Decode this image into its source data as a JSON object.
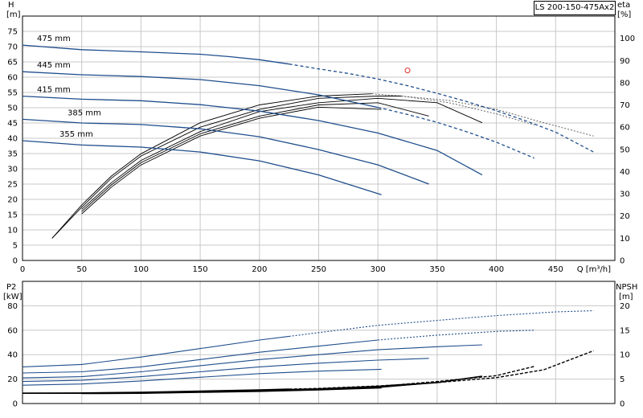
{
  "title": "LS 200-150-475Ax2",
  "chart_data": [
    {
      "type": "line",
      "name": "head-efficiency",
      "xlabel": "Q [m³/h]",
      "xlim": [
        0,
        500
      ],
      "xticks": [
        0,
        50,
        100,
        150,
        200,
        250,
        300,
        350,
        400,
        450
      ],
      "ylabel_left": [
        "H",
        "[m]"
      ],
      "ylim_left": [
        0,
        80
      ],
      "yticks_left": [
        0,
        5,
        10,
        15,
        20,
        25,
        30,
        35,
        40,
        45,
        50,
        55,
        60,
        65,
        70,
        75
      ],
      "ylabel_right": [
        "eta",
        "[%]"
      ],
      "ylim_right": [
        0,
        110
      ],
      "yticks_right": [
        0,
        10,
        20,
        30,
        40,
        50,
        60,
        70,
        80,
        90,
        100
      ],
      "grid": true,
      "colors": {
        "curve": "#1f4e8c",
        "eff": "#000000",
        "eff_dashed": "#555555",
        "marker": "#e03030"
      },
      "operating_point": {
        "x": 325,
        "y": 62.2
      },
      "head_curves": [
        {
          "label": "475 mm",
          "solid_end": 225,
          "points": [
            [
              0,
              70.5
            ],
            [
              50,
              69
            ],
            [
              100,
              68.3
            ],
            [
              150,
              67.5
            ],
            [
              175,
              66.7
            ],
            [
              200,
              65.7
            ],
            [
              225,
              64.3
            ],
            [
              250,
              62.7
            ],
            [
              275,
              61.2
            ],
            [
              300,
              59.4
            ],
            [
              325,
              57.2
            ],
            [
              350,
              54.7
            ],
            [
              375,
              52
            ],
            [
              400,
              49
            ],
            [
              425,
              45.7
            ],
            [
              450,
              42
            ],
            [
              482,
              35.5
            ]
          ]
        },
        {
          "label": "445 mm",
          "solid_end": 300,
          "points": [
            [
              0,
              61.8
            ],
            [
              50,
              60.8
            ],
            [
              100,
              60.2
            ],
            [
              150,
              59.2
            ],
            [
              200,
              57.2
            ],
            [
              250,
              54.2
            ],
            [
              300,
              50.1
            ],
            [
              325,
              47.8
            ],
            [
              350,
              45.2
            ],
            [
              375,
              42.1
            ],
            [
              400,
              38.7
            ],
            [
              432,
              33.5
            ]
          ]
        },
        {
          "label": "415 mm",
          "solid_end": 388,
          "points": [
            [
              0,
              53.8
            ],
            [
              50,
              52.8
            ],
            [
              100,
              52.3
            ],
            [
              150,
              51
            ],
            [
              200,
              48.9
            ],
            [
              250,
              45.8
            ],
            [
              300,
              41.7
            ],
            [
              350,
              36
            ],
            [
              388,
              28
            ]
          ]
        },
        {
          "label": "385 mm",
          "solid_end": 343,
          "points": [
            [
              0,
              46.2
            ],
            [
              50,
              45
            ],
            [
              100,
              44.5
            ],
            [
              150,
              43.1
            ],
            [
              200,
              40.5
            ],
            [
              250,
              36.3
            ],
            [
              300,
              31.3
            ],
            [
              343,
              25
            ]
          ]
        },
        {
          "label": "355 mm",
          "solid_end": 303,
          "points": [
            [
              0,
              39.2
            ],
            [
              50,
              37.8
            ],
            [
              100,
              37.1
            ],
            [
              150,
              35.5
            ],
            [
              200,
              32.6
            ],
            [
              250,
              28
            ],
            [
              303,
              21.5
            ]
          ]
        }
      ],
      "efficiency_curves": [
        {
          "solid_end": 295,
          "points": [
            [
              25,
              10
            ],
            [
              50,
              25
            ],
            [
              75,
              38
            ],
            [
              100,
              48
            ],
            [
              150,
              62
            ],
            [
              200,
              70
            ],
            [
              250,
              74
            ],
            [
              295,
              75
            ],
            [
              320,
              74
            ],
            [
              360,
              72
            ],
            [
              400,
              68
            ],
            [
              440,
              62
            ],
            [
              482,
              56
            ]
          ]
        },
        {
          "solid_end": 320,
          "points": [
            [
              25,
              10
            ],
            [
              50,
              24
            ],
            [
              75,
              37
            ],
            [
              100,
              47
            ],
            [
              150,
              60
            ],
            [
              200,
              68
            ],
            [
              250,
              73
            ],
            [
              300,
              74
            ],
            [
              320,
              74
            ],
            [
              360,
              71
            ],
            [
              400,
              66
            ],
            [
              432,
              61
            ]
          ]
        },
        {
          "solid_end": 388,
          "points": [
            [
              50,
              23
            ],
            [
              75,
              35
            ],
            [
              100,
              45
            ],
            [
              150,
              58
            ],
            [
              200,
              67
            ],
            [
              250,
              71
            ],
            [
              300,
              73
            ],
            [
              350,
              71
            ],
            [
              388,
              62
            ]
          ]
        },
        {
          "solid_end": 343,
          "points": [
            [
              50,
              22
            ],
            [
              75,
              34
            ],
            [
              100,
              44
            ],
            [
              150,
              57
            ],
            [
              200,
              65
            ],
            [
              250,
              70
            ],
            [
              300,
              71
            ],
            [
              343,
              65
            ]
          ]
        },
        {
          "solid_end": 303,
          "points": [
            [
              50,
              21
            ],
            [
              75,
              33
            ],
            [
              100,
              43
            ],
            [
              150,
              56
            ],
            [
              200,
              64
            ],
            [
              250,
              69
            ],
            [
              303,
              68
            ]
          ]
        }
      ]
    },
    {
      "type": "line",
      "name": "power-npsh",
      "xlim": [
        0,
        500
      ],
      "ylabel_left": [
        "P2",
        "[kW]"
      ],
      "ylim_left": [
        0,
        100
      ],
      "yticks_left": [
        0,
        20,
        40,
        60,
        80
      ],
      "ylabel_right": [
        "NPSH",
        "[m]"
      ],
      "ylim_right": [
        0,
        25
      ],
      "yticks_right": [
        0,
        5,
        10,
        15,
        20
      ],
      "grid": true,
      "power_curves": [
        {
          "solid_end": 225,
          "points": [
            [
              0,
              30
            ],
            [
              50,
              32
            ],
            [
              100,
              38
            ],
            [
              150,
              45
            ],
            [
              200,
              52
            ],
            [
              250,
              58
            ],
            [
              300,
              64
            ],
            [
              350,
              68
            ],
            [
              400,
              72
            ],
            [
              450,
              75
            ],
            [
              482,
              76
            ]
          ]
        },
        {
          "solid_end": 300,
          "points": [
            [
              0,
              25
            ],
            [
              50,
              26
            ],
            [
              100,
              30
            ],
            [
              150,
              36
            ],
            [
              200,
              42
            ],
            [
              250,
              47
            ],
            [
              300,
              52
            ],
            [
              350,
              56
            ],
            [
              400,
              59
            ],
            [
              432,
              60
            ]
          ]
        },
        {
          "solid_end": 388,
          "points": [
            [
              0,
              21
            ],
            [
              50,
              22
            ],
            [
              100,
              26
            ],
            [
              150,
              31
            ],
            [
              200,
              36
            ],
            [
              250,
              40
            ],
            [
              300,
              44
            ],
            [
              350,
              46.5
            ],
            [
              388,
              48
            ]
          ]
        },
        {
          "solid_end": 343,
          "points": [
            [
              0,
              18
            ],
            [
              50,
              19
            ],
            [
              100,
              22
            ],
            [
              150,
              26
            ],
            [
              200,
              30
            ],
            [
              250,
              33
            ],
            [
              300,
              35.5
            ],
            [
              343,
              37
            ]
          ]
        },
        {
          "solid_end": 303,
          "points": [
            [
              0,
              15
            ],
            [
              50,
              16
            ],
            [
              100,
              18.5
            ],
            [
              150,
              21.5
            ],
            [
              200,
              24.5
            ],
            [
              250,
              26.5
            ],
            [
              303,
              28
            ]
          ]
        }
      ],
      "npsh_curves": [
        {
          "solid_end": 225,
          "points": [
            [
              0,
              2.1
            ],
            [
              50,
              2.15
            ],
            [
              100,
              2.3
            ],
            [
              150,
              2.55
            ],
            [
              200,
              2.8
            ],
            [
              250,
              3.1
            ],
            [
              300,
              3.6
            ],
            [
              350,
              4.3
            ],
            [
              400,
              5.3
            ],
            [
              440,
              6.9
            ],
            [
              482,
              10.8
            ]
          ]
        },
        {
          "solid_end": 300,
          "points": [
            [
              0,
              2.1
            ],
            [
              50,
              2.1
            ],
            [
              100,
              2.2
            ],
            [
              150,
              2.4
            ],
            [
              200,
              2.7
            ],
            [
              250,
              3.0
            ],
            [
              300,
              3.5
            ],
            [
              350,
              4.5
            ],
            [
              400,
              5.7
            ],
            [
              432,
              7.6
            ]
          ]
        },
        {
          "solid_end": 388,
          "points": [
            [
              50,
              2.1
            ],
            [
              100,
              2.2
            ],
            [
              150,
              2.4
            ],
            [
              200,
              2.6
            ],
            [
              250,
              2.9
            ],
            [
              300,
              3.4
            ],
            [
              350,
              4.3
            ],
            [
              388,
              5.6
            ]
          ]
        },
        {
          "solid_end": 343,
          "points": [
            [
              50,
              2.1
            ],
            [
              100,
              2.15
            ],
            [
              150,
              2.35
            ],
            [
              200,
              2.55
            ],
            [
              250,
              2.85
            ],
            [
              300,
              3.3
            ],
            [
              343,
              4.2
            ]
          ]
        },
        {
          "solid_end": 303,
          "points": [
            [
              50,
              2.05
            ],
            [
              100,
              2.1
            ],
            [
              150,
              2.3
            ],
            [
              200,
              2.5
            ],
            [
              250,
              2.8
            ],
            [
              303,
              3.2
            ]
          ]
        }
      ]
    }
  ]
}
